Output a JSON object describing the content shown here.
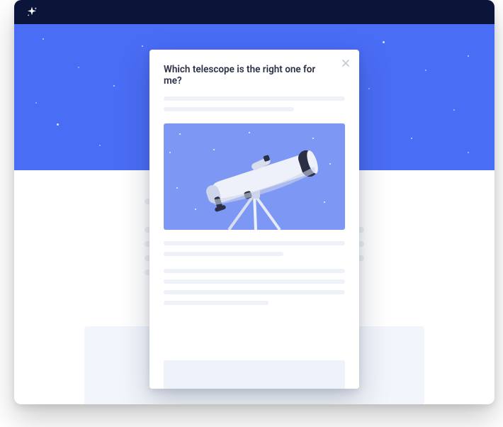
{
  "titlebar": {
    "logo_name": "sparkle-icon"
  },
  "modal": {
    "heading": "Which telescope is the right one for me?",
    "close_label": "Close"
  }
}
